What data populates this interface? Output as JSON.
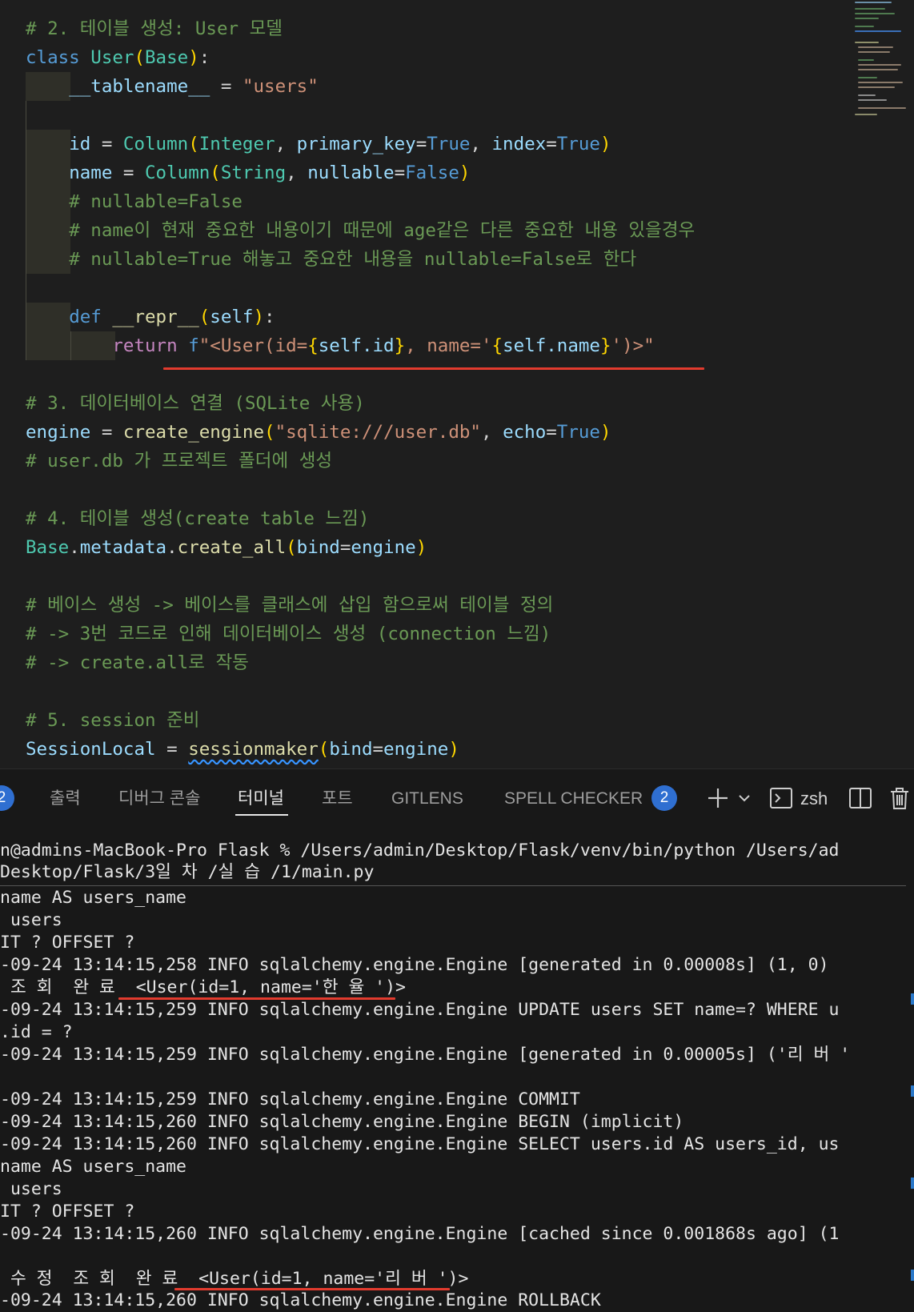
{
  "editor": {
    "code": {
      "l1": "# 2. 테이블 생성: User 모델",
      "l2_kw": "class",
      "l2_name": "User",
      "l2_base": "Base",
      "l3_attr": "__tablename__",
      "l3_val": "\"users\"",
      "l4_var": "id",
      "l4_fn": "Column",
      "l4_type": "Integer",
      "l4_arg1": "primary_key",
      "l4_val1": "True",
      "l4_arg2": "index",
      "l4_val2": "True",
      "l5_var": "name",
      "l5_fn": "Column",
      "l5_type": "String",
      "l5_arg": "nullable",
      "l5_val": "False",
      "l6": "# nullable=False",
      "l7": "# name이 현재 중요한 내용이기 때문에 age같은 다른 중요한 내용 있을경우",
      "l8": "# nullable=True 해놓고 중요한 내용을 nullable=False로 한다",
      "l9_kw": "def",
      "l9_fn": "__repr__",
      "l9_param": "self",
      "l10_kw": "return",
      "l10_f": "f",
      "l10_s1": "\"<User(id=",
      "l10_e1": "self.id",
      "l10_s2": ", name='",
      "l10_e2": "self.name",
      "l10_s3": "')>\"",
      "l11": "# 3. 데이터베이스 연결 (SQLite 사용)",
      "l12_var": "engine",
      "l12_fn": "create_engine",
      "l12_str": "\"sqlite:///user.db\"",
      "l12_arg": "echo",
      "l12_val": "True",
      "l13": "# user.db 가 프로젝트 폴더에 생성",
      "l14": "# 4. 테이블 생성(create table 느낌)",
      "l15_obj": "Base",
      "l15_attr": "metadata",
      "l15_fn": "create_all",
      "l15_arg": "bind",
      "l15_val": "engine",
      "l16": "# 베이스 생성 -> 베이스를 클래스에 삽입 함으로써 테이블 정의",
      "l17": "# -> 3번 코드로 인해 데이터베이스 생성 (connection 느낌)",
      "l18": "# -> create.all로 작동",
      "l19": "# 5. session 준비",
      "l20_var": "SessionLocal",
      "l20_fn": "sessionmaker",
      "l20_arg": "bind",
      "l20_val": "engine"
    }
  },
  "panel": {
    "left_badge": "2",
    "tabs": [
      "출력",
      "디버그 콘솔",
      "터미널",
      "포트",
      "GITLENS",
      "SPELL CHECKER"
    ],
    "active_tab": "터미널",
    "spell_badge": "2",
    "shell": "zsh"
  },
  "terminal": {
    "lines": [
      "n@admins-MacBook-Pro Flask % /Users/admin/Desktop/Flask/venv/bin/python /Users/ad",
      "Desktop/Flask/3일 차 /실 습 /1/main.py",
      "name AS users_name",
      " users",
      "IT ? OFFSET ?",
      "-09-24 13:14:15,258 INFO sqlalchemy.engine.Engine [generated in 0.00008s] (1, 0)",
      " 조 회  완 료  <User(id=1, name='한 율 ')>",
      "-09-24 13:14:15,259 INFO sqlalchemy.engine.Engine UPDATE users SET name=? WHERE u",
      ".id = ?",
      "-09-24 13:14:15,259 INFO sqlalchemy.engine.Engine [generated in 0.00005s] ('리 버 '",
      "",
      "-09-24 13:14:15,259 INFO sqlalchemy.engine.Engine COMMIT",
      "-09-24 13:14:15,260 INFO sqlalchemy.engine.Engine BEGIN (implicit)",
      "-09-24 13:14:15,260 INFO sqlalchemy.engine.Engine SELECT users.id AS users_id, us",
      "name AS users_name",
      " users",
      "IT ? OFFSET ?",
      "-09-24 13:14:15,260 INFO sqlalchemy.engine.Engine [cached since 0.001868s ago] (1",
      "",
      " 수 정  조 회  완 료  <User(id=1, name='리 버 ')>",
      "-09-24 13:14:15,260 INFO sqlalchemy.engine.Engine ROLLBACK"
    ]
  }
}
